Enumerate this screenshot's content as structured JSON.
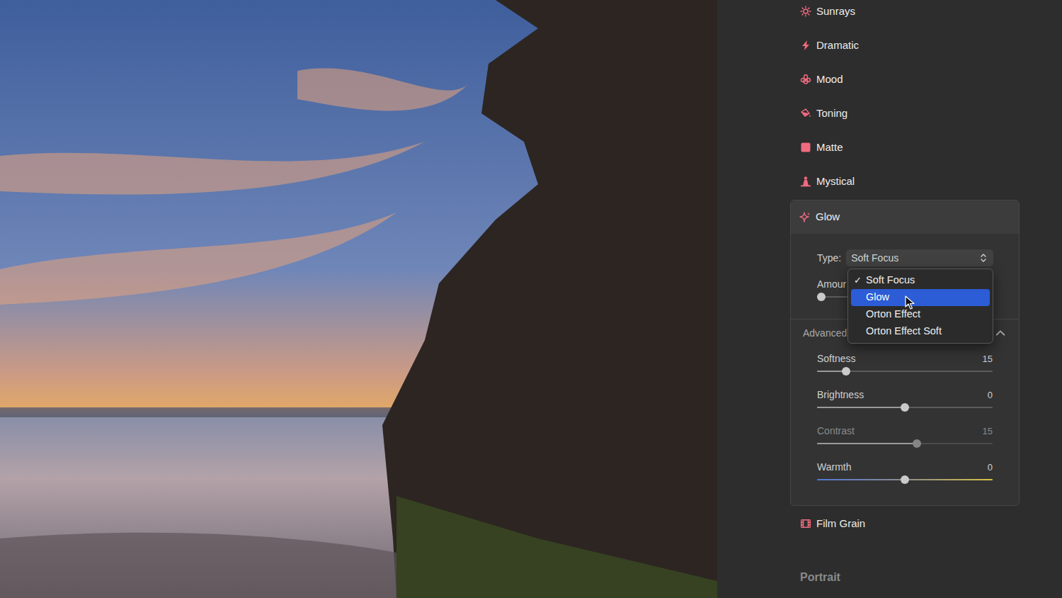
{
  "effects": [
    {
      "label": "Sunrays"
    },
    {
      "label": "Dramatic"
    },
    {
      "label": "Mood"
    },
    {
      "label": "Toning"
    },
    {
      "label": "Matte"
    },
    {
      "label": "Mystical"
    }
  ],
  "glow": {
    "title": "Glow",
    "expanded": true,
    "type_label": "Type:",
    "type_value": "Soft Focus",
    "amount": {
      "label": "Amour",
      "level": 0
    },
    "menu": {
      "open": true,
      "check_mark": "✓",
      "items": [
        {
          "label": "Soft Focus",
          "checked": true,
          "selected": false
        },
        {
          "label": "Glow",
          "checked": false,
          "selected": true
        },
        {
          "label": "Orton Effect",
          "checked": false,
          "selected": false
        },
        {
          "label": "Orton Effect Soft",
          "checked": false,
          "selected": false
        }
      ]
    },
    "advanced": {
      "label": "Advanced",
      "expanded": true,
      "sliders": [
        {
          "label": "Softness",
          "value": "15",
          "level": 0.15,
          "disabled": false,
          "kind": "plain"
        },
        {
          "label": "Brightness",
          "value": "0",
          "level": 0.5,
          "disabled": false,
          "kind": "plain"
        },
        {
          "label": "Contrast",
          "value": "15",
          "level": 0.57,
          "disabled": true,
          "kind": "plain"
        },
        {
          "label": "Warmth",
          "value": "0",
          "level": 0.5,
          "disabled": false,
          "kind": "warmth"
        }
      ]
    }
  },
  "effects_below": [
    {
      "label": "Film Grain"
    }
  ],
  "section": {
    "label": "Portrait"
  }
}
